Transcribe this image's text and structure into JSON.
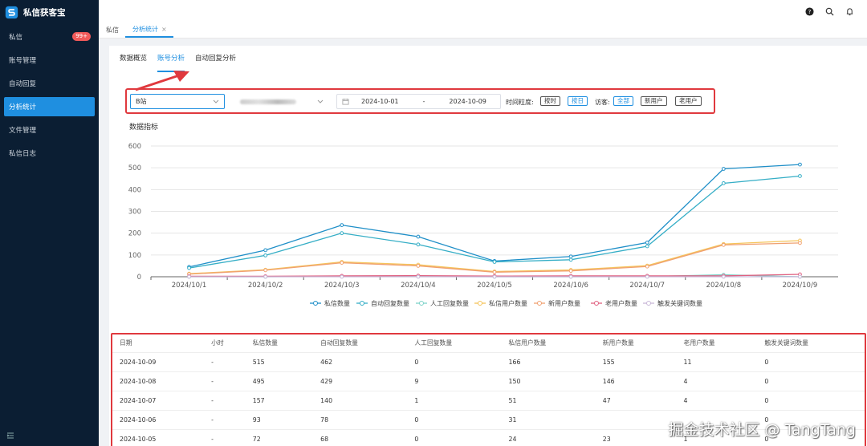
{
  "app": {
    "name": "私信获客宝"
  },
  "sidebar": {
    "items": [
      {
        "label": "私信",
        "badge": "99+"
      },
      {
        "label": "账号管理"
      },
      {
        "label": "自动回复"
      },
      {
        "label": "分析统计"
      },
      {
        "label": "文件管理"
      },
      {
        "label": "私信日志"
      }
    ],
    "active": 3
  },
  "top_icons": [
    "help-icon",
    "search-icon",
    "bell-icon"
  ],
  "page_tabs": [
    {
      "label": "私信"
    },
    {
      "label": "分析统计",
      "closable": true
    }
  ],
  "sub_tabs": [
    {
      "label": "数据概览"
    },
    {
      "label": "账号分析"
    },
    {
      "label": "自动回复分析"
    }
  ],
  "sub_tab_active": 1,
  "filters": {
    "platform": "B站",
    "account_placeholder": "",
    "date_start": "2024-10-01",
    "date_sep": "-",
    "date_end": "2024-10-09",
    "granularity_label": "时间粒度:",
    "granularity_options": [
      "按时",
      "按日"
    ],
    "granularity_selected": "按日",
    "visitor_label": "访客:",
    "visitor_options": [
      "全部",
      "新用户",
      "老用户"
    ],
    "visitor_selected": "全部"
  },
  "chart_title": "数据指标",
  "chart_data": {
    "type": "line",
    "categories": [
      "2024/10/1",
      "2024/10/2",
      "2024/10/3",
      "2024/10/4",
      "2024/10/5",
      "2024/10/6",
      "2024/10/7",
      "2024/10/8",
      "2024/10/9"
    ],
    "ylim": [
      0,
      600
    ],
    "yticks": [
      0,
      100,
      200,
      300,
      400,
      500,
      600
    ],
    "grid": true,
    "legend": "bottom",
    "series": [
      {
        "name": "私信数量",
        "color": "#1f8fc8",
        "values": [
          45,
          122,
          237,
          184,
          72,
          93,
          157,
          495,
          515
        ]
      },
      {
        "name": "自动回复数量",
        "color": "#35aec6",
        "values": [
          40,
          98,
          200,
          148,
          68,
          78,
          140,
          429,
          462
        ]
      },
      {
        "name": "人工回复数量",
        "color": "#7ed3c9",
        "values": [
          0,
          0,
          2,
          1,
          0,
          0,
          1,
          9,
          0
        ]
      },
      {
        "name": "私信用户数量",
        "color": "#f5c45a",
        "values": [
          14,
          32,
          68,
          55,
          24,
          31,
          51,
          150,
          166
        ]
      },
      {
        "name": "新用户数量",
        "color": "#f0a070",
        "values": [
          12,
          30,
          64,
          50,
          21,
          27,
          47,
          146,
          155
        ]
      },
      {
        "name": "老用户数量",
        "color": "#e06080",
        "values": [
          2,
          2,
          4,
          5,
          3,
          4,
          4,
          4,
          11
        ]
      },
      {
        "name": "触发关键词数量",
        "color": "#c9b8d8",
        "values": [
          0,
          0,
          0,
          0,
          0,
          0,
          0,
          0,
          0
        ]
      }
    ]
  },
  "table": {
    "headers": [
      "日期",
      "小时",
      "私信数量",
      "自动回复数量",
      "人工回复数量",
      "私信用户数量",
      "新用户数量",
      "老用户数量",
      "触发关键词数量"
    ],
    "rows": [
      [
        "2024-10-09",
        "-",
        "515",
        "462",
        "0",
        "166",
        "155",
        "11",
        "0"
      ],
      [
        "2024-10-08",
        "-",
        "495",
        "429",
        "9",
        "150",
        "146",
        "4",
        "0"
      ],
      [
        "2024-10-07",
        "-",
        "157",
        "140",
        "1",
        "51",
        "47",
        "4",
        "0"
      ],
      [
        "2024-10-06",
        "-",
        "93",
        "78",
        "0",
        "31",
        "",
        "",
        "0"
      ],
      [
        "2024-10-05",
        "-",
        "72",
        "68",
        "0",
        "24",
        "23",
        "1",
        "0"
      ]
    ]
  },
  "watermark": "掘金技术社区 @ TangTang"
}
